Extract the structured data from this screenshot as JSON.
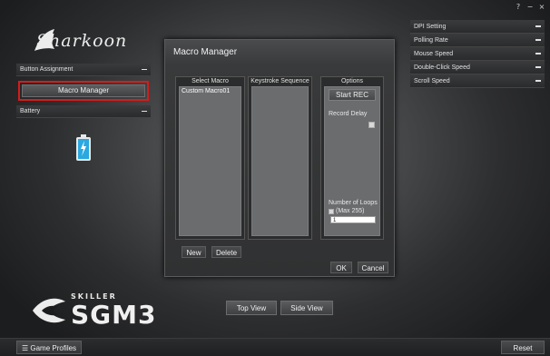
{
  "window_controls": {
    "help": "?",
    "minimize": "−",
    "close": "×"
  },
  "brand": {
    "logo_text": "Sharkoon",
    "series": "SKILLER",
    "model": "SGM3"
  },
  "left_panel": {
    "button_assignment": "Button Assignment",
    "macro_manager": "Macro Manager",
    "battery": "Battery"
  },
  "right_panel": {
    "items": [
      "DPI Setting",
      "Polling Rate",
      "Mouse Speed",
      "Double-Click Speed",
      "Scroll Speed"
    ]
  },
  "dialog": {
    "title": "Macro Manager",
    "select_macro": "Select Macro",
    "macros": [
      "Custom Macro01"
    ],
    "keystroke_sequence": "Keystroke Sequence",
    "options": "Options",
    "start_rec": "Start REC",
    "record_delay": "Record Delay",
    "number_of_loops": "Number of Loops",
    "max_note": "(Max 255)",
    "loops_value": "1",
    "new": "New",
    "delete": "Delete",
    "ok": "OK",
    "cancel": "Cancel"
  },
  "views": {
    "top": "Top View",
    "side": "Side View"
  },
  "bottom": {
    "game_profiles": "Game Profiles",
    "reset": "Reset"
  },
  "colors": {
    "highlight": "#d81b1b",
    "battery": "#2aa8e0"
  }
}
